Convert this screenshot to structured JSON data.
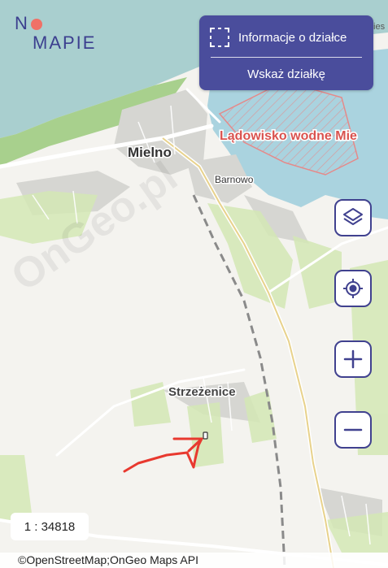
{
  "logo": {
    "line1": "N",
    "line2": "MAPIE"
  },
  "info_panel": {
    "title": "Informacje o działce",
    "pick_button": "Wskaż działkę",
    "icon": "parcel-select-icon"
  },
  "map_labels": {
    "town_mielno": "Mielno",
    "village_barnowo": "Barnowo",
    "village_strzezenice": "Strzeżenice",
    "seaplane_area": "Lądowisko wodne Mie",
    "watermark": "OnGeo.pl",
    "top_right_fragment": "Unies"
  },
  "controls": {
    "layers_icon": "layers-icon",
    "locate_icon": "locate-icon",
    "zoom_in_icon": "plus-icon",
    "zoom_out_icon": "minus-icon"
  },
  "scale": "1 : 34818",
  "attribution": {
    "osm": "©OpenStreetMap",
    "separator": ";",
    "ongeo": "OnGeo Maps API"
  },
  "colors": {
    "brand": "#40418f",
    "panel_bg": "#4a4d9c",
    "sea": "#a9cfcf",
    "lake": "#aad3df",
    "forest": "#a8d08d",
    "residential": "#d9d9d9",
    "restricted_area": "#f07167",
    "annotation": "#e8392f"
  }
}
